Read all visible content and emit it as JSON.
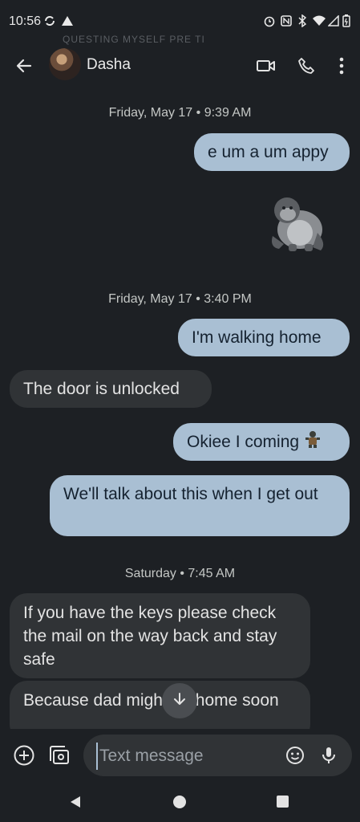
{
  "status_bar": {
    "time": "10:56"
  },
  "ghost_text": "QUESTING MYSELF PRE TI",
  "header": {
    "contact_name": "Dasha"
  },
  "thread": {
    "date_1": "Friday, May 17 • 9:39 AM",
    "msg_1": "e um a um appy",
    "msg_2_emoji_icon": "gorilla-sticker",
    "date_2": "Friday, May 17 • 3:40 PM",
    "msg_3": "I'm walking home",
    "msg_4": "The door is unlocked",
    "msg_5": "Okiee I coming",
    "msg_6": "We'll talk about this when I get out",
    "date_3": "Saturday • 7:45 AM",
    "msg_7": "If you have the keys please check the mail on the way back and stay safe",
    "msg_8": "Because dad might be home soon"
  },
  "composer": {
    "placeholder": "Text message"
  },
  "colors": {
    "background": "#1d2024",
    "outgoing": "#a9bfd3",
    "incoming": "#303336"
  }
}
